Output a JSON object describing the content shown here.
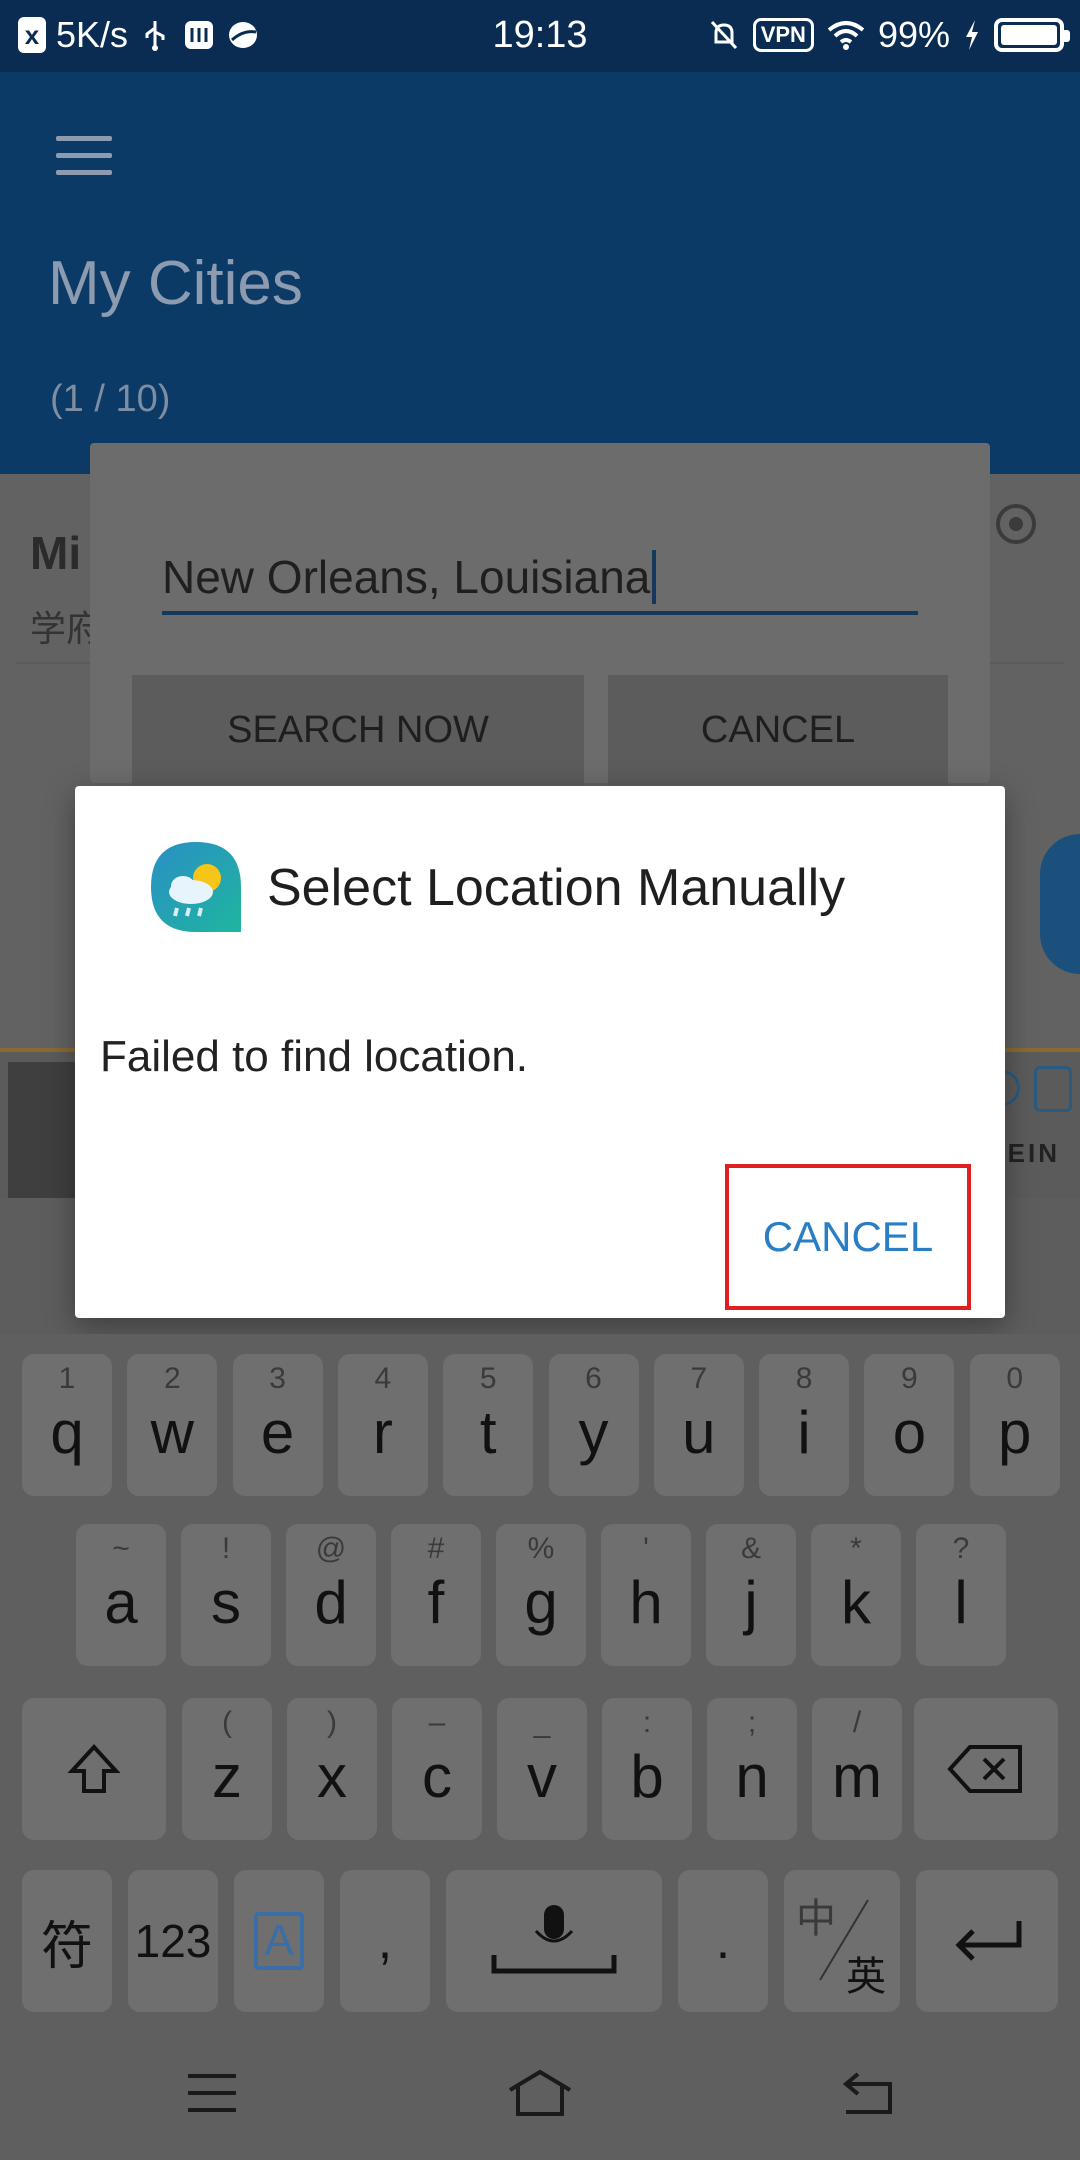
{
  "status_bar": {
    "speed": "5K/s",
    "time": "19:13",
    "vpn": "VPN",
    "battery": "99%"
  },
  "header": {
    "title": "My Cities",
    "count": "(1 / 10)"
  },
  "background": {
    "city_name": "Mi",
    "city_sub": "学府",
    "ad_text": "EIN"
  },
  "search_dialog": {
    "input_value": "New Orleans, Louisiana",
    "search_button": "SEARCH NOW",
    "cancel_button": "CANCEL"
  },
  "alert": {
    "title": "Select Location Manually",
    "message": "Failed to find location.",
    "cancel_button": "CANCEL"
  },
  "keyboard": {
    "row1": [
      {
        "num": "1",
        "ch": "q"
      },
      {
        "num": "2",
        "ch": "w"
      },
      {
        "num": "3",
        "ch": "e"
      },
      {
        "num": "4",
        "ch": "r"
      },
      {
        "num": "5",
        "ch": "t"
      },
      {
        "num": "6",
        "ch": "y"
      },
      {
        "num": "7",
        "ch": "u"
      },
      {
        "num": "8",
        "ch": "i"
      },
      {
        "num": "9",
        "ch": "o"
      },
      {
        "num": "0",
        "ch": "p"
      }
    ],
    "row2": [
      {
        "num": "~",
        "ch": "a"
      },
      {
        "num": "!",
        "ch": "s"
      },
      {
        "num": "@",
        "ch": "d"
      },
      {
        "num": "#",
        "ch": "f"
      },
      {
        "num": "%",
        "ch": "g"
      },
      {
        "num": "'",
        "ch": "h"
      },
      {
        "num": "&",
        "ch": "j"
      },
      {
        "num": "*",
        "ch": "k"
      },
      {
        "num": "?",
        "ch": "l"
      }
    ],
    "row3": [
      {
        "num": "(",
        "ch": "z"
      },
      {
        "num": ")",
        "ch": "x"
      },
      {
        "num": "–",
        "ch": "c"
      },
      {
        "num": "_",
        "ch": "v"
      },
      {
        "num": ":",
        "ch": "b"
      },
      {
        "num": ";",
        "ch": "n"
      },
      {
        "num": "/",
        "ch": "m"
      }
    ],
    "symbols": "符",
    "numbers": "123",
    "lang_a": "A",
    "comma": ",",
    "period": ".",
    "zh": "中",
    "en": "英"
  }
}
